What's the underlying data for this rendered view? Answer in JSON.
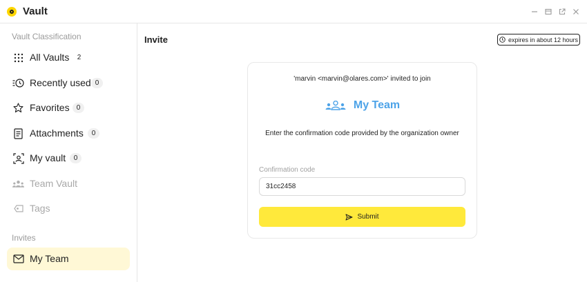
{
  "app": {
    "title": "Vault"
  },
  "window_controls": [
    "minimize-icon",
    "restore-icon",
    "popout-icon",
    "close-icon"
  ],
  "sidebar": {
    "classification_title": "Vault Classification",
    "items": [
      {
        "label": "All Vaults",
        "count": "2",
        "icon": "grid-dots-icon"
      },
      {
        "label": "Recently used",
        "count": "0",
        "icon": "recent-clock-icon"
      },
      {
        "label": "Favorites",
        "count": "0",
        "icon": "star-icon"
      },
      {
        "label": "Attachments",
        "count": "0",
        "icon": "document-icon"
      },
      {
        "label": "My vault",
        "count": "0",
        "icon": "person-frame-icon"
      },
      {
        "label": "Team Vault",
        "icon": "team-icon"
      },
      {
        "label": "Tags",
        "icon": "tag-icon"
      }
    ],
    "invites_title": "Invites",
    "invites": [
      {
        "label": "My Team",
        "icon": "mail-icon"
      }
    ]
  },
  "main": {
    "title": "Invite",
    "expires": "expires in about 12 hours",
    "card": {
      "invite_text": "'marvin <marvin@olares.com>'  invited to join",
      "team_name": "My Team",
      "instruction": "Enter the confirmation code provided by the organization owner",
      "code_label": "Confirmation code",
      "code_value": "31cc2458",
      "submit_label": "Submit"
    }
  },
  "colors": {
    "accent_yellow": "#ffe93b",
    "active_bg": "#fff8d6",
    "team_blue": "#4da3e8"
  }
}
